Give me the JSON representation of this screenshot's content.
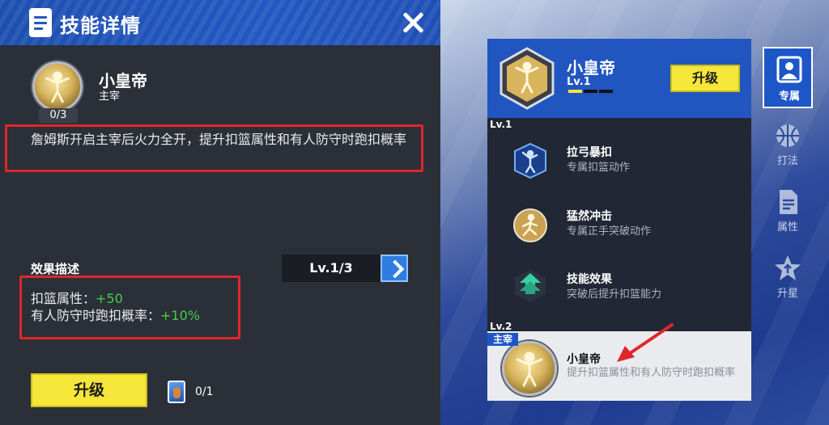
{
  "panel": {
    "title": "技能详情",
    "skill_name": "小皇帝",
    "skill_role": "主宰",
    "badge_count": "0/3",
    "description": "詹姆斯开启主宰后火力全开，提升扣篮属性和有人防守时跑扣概率",
    "effect_title": "效果描述",
    "level_selector": "Lv.1/3",
    "effects": [
      {
        "label": "扣篮属性：",
        "value": "+50"
      },
      {
        "label": "有人防守时跑扣概率：",
        "value": "+10%"
      }
    ],
    "upgrade_label": "升级",
    "card_count": "0/1"
  },
  "skill_card": {
    "name": "小皇帝",
    "level": "Lv.1",
    "upgrade_label": "升级",
    "progress_filled_fraction": 0.33
  },
  "list": {
    "lv1_tag": "Lv.1",
    "items": [
      {
        "title": "拉弓暴扣",
        "subtitle": "专属扣篮动作"
      },
      {
        "title": "猛然冲击",
        "subtitle": "专属正手突破动作"
      },
      {
        "title": "技能效果",
        "subtitle": "突破后提升扣篮能力"
      }
    ],
    "lv2_tag": "Lv.2",
    "lv2_ribbon": "主宰",
    "lv2_title": "小皇帝",
    "lv2_desc": "提升扣篮属性和有人防守时跑扣概率"
  },
  "tabs": [
    {
      "label": "专属",
      "icon": "player-card-icon",
      "active": true
    },
    {
      "label": "打法",
      "icon": "basketball-icon",
      "active": false
    },
    {
      "label": "属性",
      "icon": "document-icon",
      "active": false
    },
    {
      "label": "升星",
      "icon": "star-icon",
      "active": false
    }
  ],
  "colors": {
    "accent_blue": "#2155c0",
    "upgrade_yellow": "#f5e63a",
    "highlight_red": "#e0262b",
    "positive_green": "#3fd14a"
  }
}
